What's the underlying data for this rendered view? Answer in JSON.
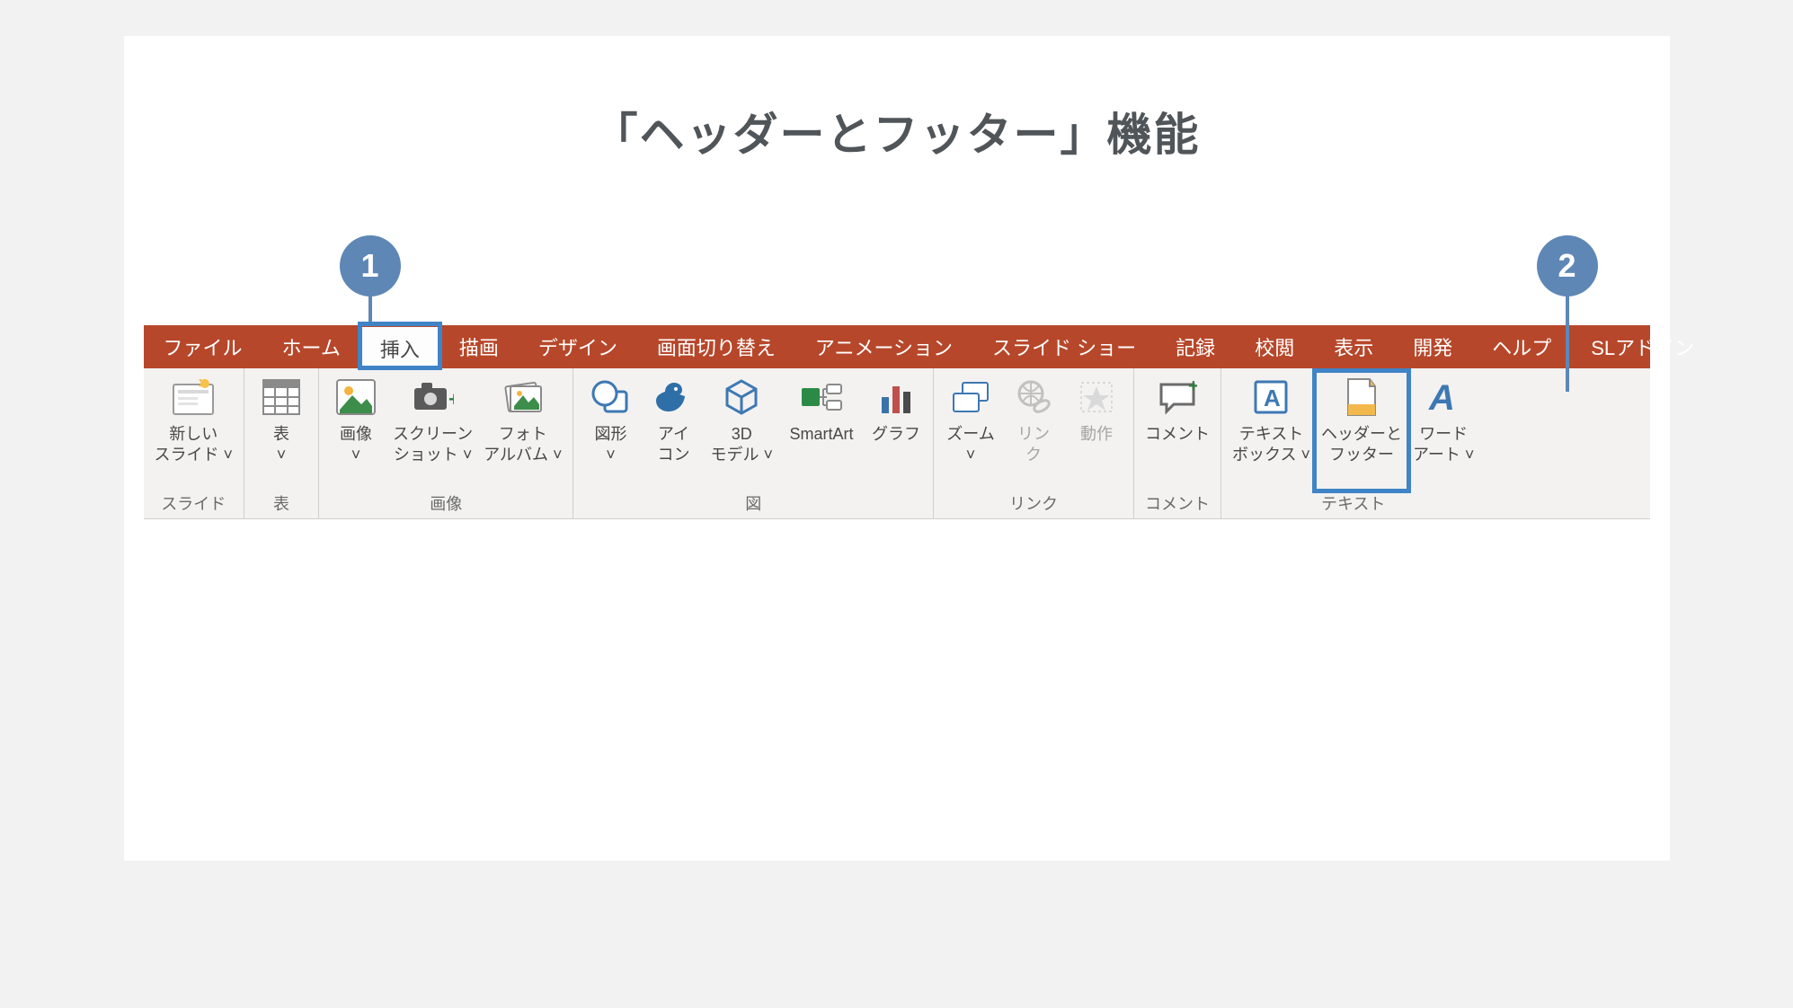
{
  "title": "「ヘッダーとフッター」機能",
  "callouts": {
    "one": "1",
    "two": "2"
  },
  "tabs": {
    "file": "ファイル",
    "home": "ホーム",
    "insert": "挿入",
    "draw": "描画",
    "design": "デザイン",
    "transition": "画面切り替え",
    "animation": "アニメーション",
    "slideshow": "スライド ショー",
    "record": "記録",
    "review": "校閲",
    "view": "表示",
    "developer": "開発",
    "help": "ヘルプ",
    "sladdin": "SLアドイン"
  },
  "groups": {
    "slides": {
      "label": "スライド",
      "new_slide": "新しい\nスライド ˅"
    },
    "tables": {
      "label": "表",
      "table": "表\n˅"
    },
    "images": {
      "label": "画像",
      "picture": "画像\n˅",
      "screenshot": "スクリーン\nショット ˅",
      "photo_album": "フォト\nアルバム ˅"
    },
    "illustrations": {
      "label": "図",
      "shapes": "図形\n˅",
      "icons": "アイ\nコン",
      "model3d": "3D\nモデル ˅",
      "smartart": "SmartArt",
      "chart": "グラフ"
    },
    "links": {
      "label": "リンク",
      "zoom": "ズーム\n˅",
      "link": "リン\nク",
      "action": "動作"
    },
    "comments": {
      "label": "コメント",
      "comment": "コメント"
    },
    "text": {
      "label": "テキスト",
      "textbox": "テキスト\nボックス ˅",
      "header_footer": "ヘッダーと\nフッター",
      "wordart": "ワード\nアート ˅"
    }
  },
  "colors": {
    "accent": "#5e87b6",
    "ribbon_red": "#b7472a",
    "highlight_blue": "#3f84c6"
  }
}
